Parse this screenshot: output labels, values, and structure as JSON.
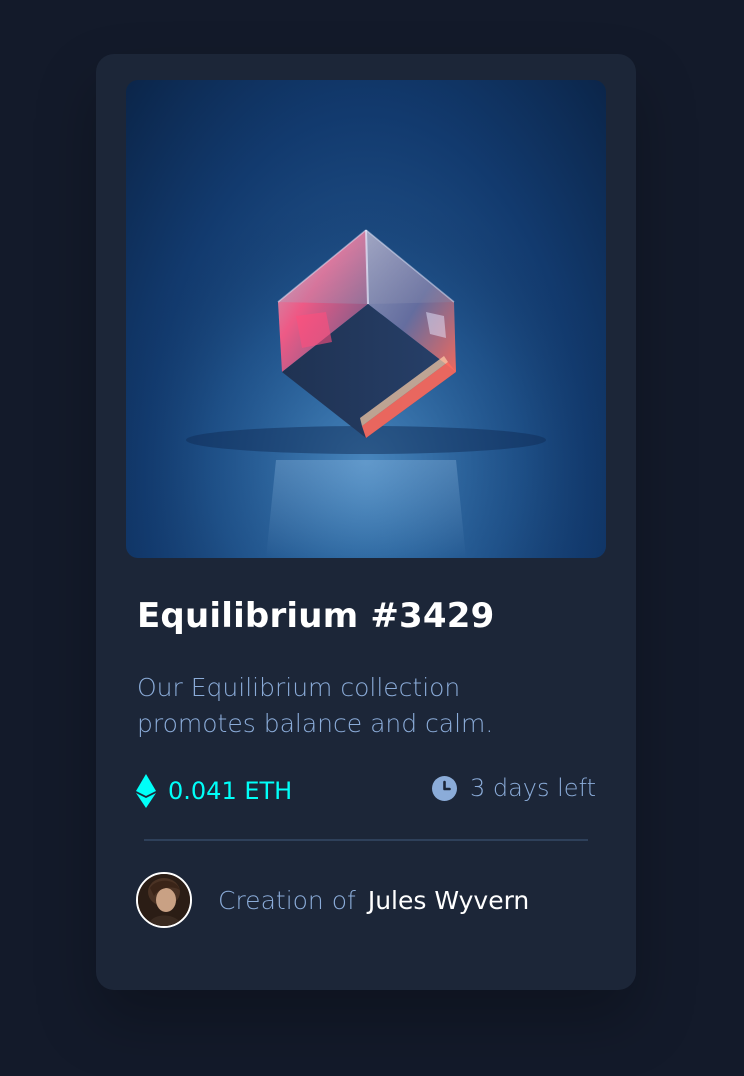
{
  "card": {
    "title": "Equilibrium",
    "number": "#3429",
    "description": "Our Equilibrium collection promotes balance and calm.",
    "price": "0.041 ETH",
    "time_left": "3 days left",
    "creator_prefix": "Creation of",
    "creator_name": "Jules Wyvern"
  },
  "icons": {
    "price": "ethereum-icon",
    "time": "clock-icon"
  },
  "colors": {
    "page_bg": "#131a2a",
    "card_bg": "#1c2638",
    "accent_cyan": "#00fff8",
    "soft_blue": "#8bacd9",
    "white": "#ffffff",
    "divider": "#2e405a"
  }
}
